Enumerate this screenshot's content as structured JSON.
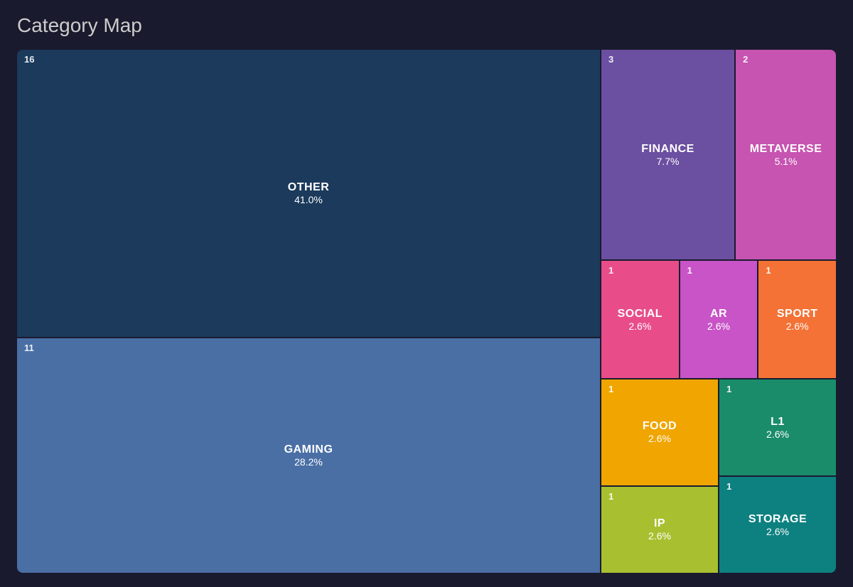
{
  "title": "Category Map",
  "cells": {
    "other": {
      "count": "16",
      "label": "OTHER",
      "value": "41.0%"
    },
    "gaming": {
      "count": "11",
      "label": "GAMING",
      "value": "28.2%"
    },
    "finance": {
      "count": "3",
      "label": "FINANCE",
      "value": "7.7%"
    },
    "metaverse": {
      "count": "2",
      "label": "METAVERSE",
      "value": "5.1%"
    },
    "social": {
      "count": "1",
      "label": "SOCIAL",
      "value": "2.6%"
    },
    "ar": {
      "count": "1",
      "label": "AR",
      "value": "2.6%"
    },
    "sport": {
      "count": "1",
      "label": "SPORT",
      "value": "2.6%"
    },
    "food": {
      "count": "1",
      "label": "FOOD",
      "value": "2.6%"
    },
    "ip": {
      "count": "1",
      "label": "IP",
      "value": "2.6%"
    },
    "l1": {
      "count": "1",
      "label": "L1",
      "value": "2.6%"
    },
    "storage": {
      "count": "1",
      "label": "STORAGE",
      "value": "2.6%"
    }
  }
}
